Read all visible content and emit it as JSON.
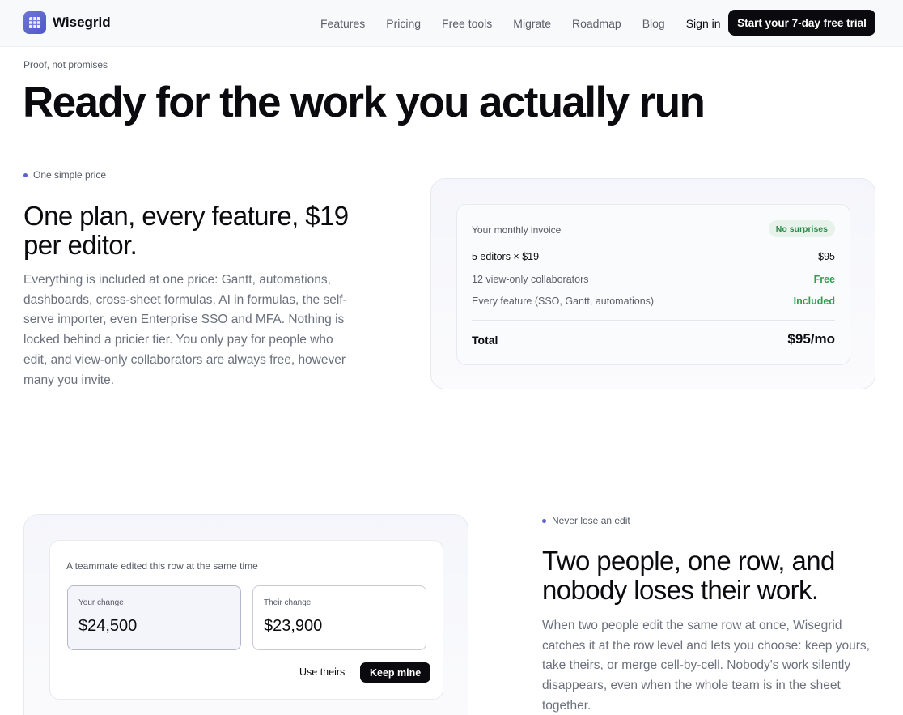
{
  "header": {
    "brand": "Wisegrid",
    "nav": [
      "Features",
      "Pricing",
      "Free tools",
      "Migrate",
      "Roadmap",
      "Blog"
    ],
    "signin": "Sign in",
    "cta": "Start your 7-day free trial"
  },
  "hero": {
    "eyebrow": "Proof, not promises",
    "title": "Ready for the work you actually run"
  },
  "pricing": {
    "tag": "One simple price",
    "title": "One plan, every feature, $19 per editor.",
    "body": "Everything is included at one price: Gantt, automations, dashboards, cross-sheet formulas, AI in formulas, the self-serve importer, even Enterprise SSO and MFA. Nothing is locked behind a pricier tier. You only pay for people who edit, and view-only collaborators are always free, however many you invite.",
    "invoice": {
      "heading": "Your monthly invoice",
      "badge": "No surprises",
      "rows": [
        {
          "label": "5 editors × $19",
          "value": "$95"
        },
        {
          "label": "12 view-only collaborators",
          "value": "Free"
        },
        {
          "label": "Every feature (SSO, Gantt, automations)",
          "value": "Included"
        }
      ],
      "total_label": "Total",
      "total_value": "$95/mo"
    }
  },
  "conflict": {
    "tag": "Never lose an edit",
    "title": "Two people, one row, and nobody loses their work.",
    "body": "When two people edit the same row at once, Wisegrid catches it at the row level and lets you choose: keep yours, take theirs, or merge cell-by-cell. Nobody's work silently disappears, even when the whole team is in the sheet together.",
    "card": {
      "heading": "A teammate edited this row at the same time",
      "your_label": "Your change",
      "your_value": "$24,500",
      "their_label": "Their change",
      "their_value": "$23,900",
      "use_theirs": "Use theirs",
      "keep_mine": "Keep mine"
    }
  },
  "colors": {
    "accent": "#5a63c8",
    "positive": "#2f9d4f",
    "ink": "#0b0b0f"
  }
}
